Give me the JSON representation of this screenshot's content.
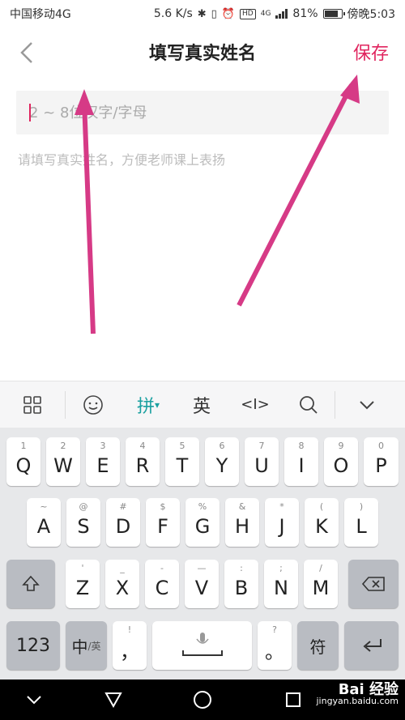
{
  "status_bar": {
    "carrier": "中国移动4G",
    "speed": "5.6 K/s",
    "network": "4G",
    "battery": "81%",
    "time": "傍晚5:03"
  },
  "header": {
    "title": "填写真实姓名",
    "save_label": "保存"
  },
  "form": {
    "name_placeholder": "2 ~ 8位汉字/字母",
    "name_value": "",
    "hint": "请填写真实姓名，方便老师课上表扬"
  },
  "annotation": {
    "arrow_color": "#d63a86"
  },
  "keyboard_toolbar": {
    "pinyin_label": "拼",
    "english_label": "英",
    "cursor_label": "<I>",
    "active_color": "#1aa0a0"
  },
  "keyboard": {
    "row1": [
      {
        "main": "Q",
        "sub": "1"
      },
      {
        "main": "W",
        "sub": "2"
      },
      {
        "main": "E",
        "sub": "3"
      },
      {
        "main": "R",
        "sub": "4"
      },
      {
        "main": "T",
        "sub": "5"
      },
      {
        "main": "Y",
        "sub": "6"
      },
      {
        "main": "U",
        "sub": "7"
      },
      {
        "main": "I",
        "sub": "8"
      },
      {
        "main": "O",
        "sub": "9"
      },
      {
        "main": "P",
        "sub": "0"
      }
    ],
    "row2": [
      {
        "main": "A",
        "sub": "~"
      },
      {
        "main": "S",
        "sub": "@"
      },
      {
        "main": "D",
        "sub": "#"
      },
      {
        "main": "F",
        "sub": "$"
      },
      {
        "main": "G",
        "sub": "%"
      },
      {
        "main": "H",
        "sub": "&"
      },
      {
        "main": "J",
        "sub": "*"
      },
      {
        "main": "K",
        "sub": "("
      },
      {
        "main": "L",
        "sub": ")"
      }
    ],
    "row3": [
      {
        "main": "Z",
        "sub": "'"
      },
      {
        "main": "X",
        "sub": "_"
      },
      {
        "main": "C",
        "sub": "-"
      },
      {
        "main": "V",
        "sub": "—"
      },
      {
        "main": "B",
        "sub": ":"
      },
      {
        "main": "N",
        "sub": ";"
      },
      {
        "main": "M",
        "sub": "/"
      }
    ],
    "row4": {
      "num_label": "123",
      "zh_label": "中",
      "zh_sub": "/英",
      "comma_sub": "!",
      "comma_main": "，",
      "period_sub": "?",
      "period_main": "。",
      "symbol_label": "符"
    }
  },
  "watermark": {
    "main": "Bai 经验",
    "sub": "jingyan.baidu.com"
  }
}
